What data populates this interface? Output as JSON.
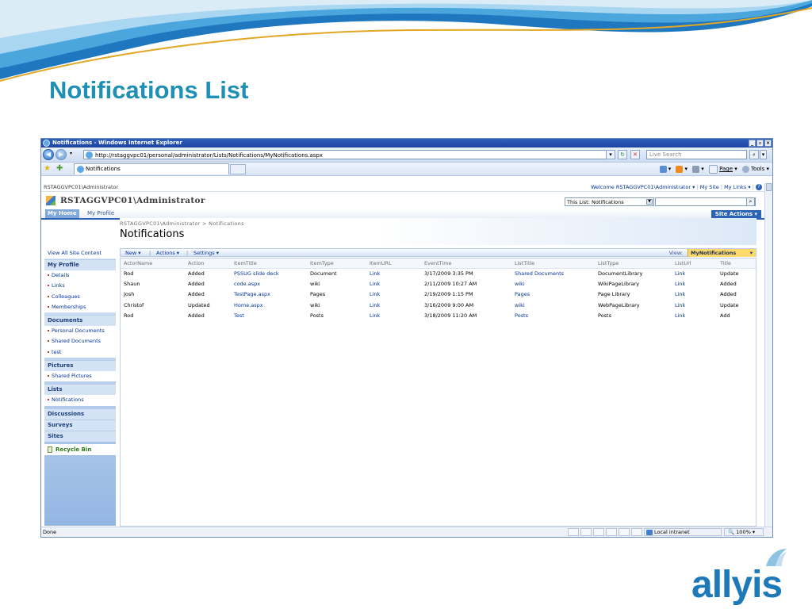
{
  "slide": {
    "title": "Notifications List",
    "logo": "allyis"
  },
  "browser": {
    "window_title": "Notifications - Windows Internet Explorer",
    "address": "http://rstaggvpc01/personal/administrator/Lists/Notifications/MyNotifications.aspx",
    "live_search_placeholder": "Live Search",
    "tab_label": "Notifications",
    "cmd_page": "Page",
    "cmd_tools": "Tools",
    "status_text": "Done",
    "zone_text": "Local intranet",
    "zoom_text": "100%"
  },
  "sharepoint": {
    "top_breadcrumb": "RSTAGGVPC01\\Administrator",
    "welcome": "Welcome RSTAGGVPC01\\Administrator ▾",
    "my_site": "My Site",
    "my_links": "My Links ▾",
    "site_title": "RSTAGGVPC01\\Administrator",
    "search_scope": "This List: Notifications",
    "nav_tabs": [
      "My Home",
      "My Profile"
    ],
    "site_actions": "Site Actions ▾",
    "breadcrumb": "RSTAGGVPC01\\Administrator > Notifications",
    "page_title": "Notifications",
    "toolbar": {
      "new": "New ▾",
      "actions": "Actions ▾",
      "settings": "Settings ▾",
      "view_label": "View:",
      "view_value": "MyNotifications"
    }
  },
  "leftnav": {
    "view_all": "View All Site Content",
    "my_profile": "My Profile",
    "profile_items": [
      "Details",
      "Links",
      "Colleagues",
      "Memberships"
    ],
    "documents": "Documents",
    "document_items": [
      "Personal Documents",
      "Shared Documents",
      "test"
    ],
    "pictures": "Pictures",
    "picture_items": [
      "Shared Pictures"
    ],
    "lists": "Lists",
    "list_items": [
      "Notifications"
    ],
    "discussions": "Discussions",
    "surveys": "Surveys",
    "sites": "Sites",
    "recycle_bin": "Recycle Bin"
  },
  "table": {
    "columns": [
      "ActorName",
      "Action",
      "ItemTitle",
      "ItemType",
      "ItemURL",
      "EventTime",
      "ListTitle",
      "ListType",
      "ListUrl",
      "Title"
    ],
    "rows": [
      [
        "Rod",
        "Added",
        "PSSUG slide deck",
        "Document",
        "Link",
        "3/17/2009 3:35 PM",
        "Shared Documents",
        "DocumentLibrary",
        "Link",
        "Update"
      ],
      [
        "Shaun",
        "Added",
        "code.aspx",
        "wiki",
        "Link",
        "2/11/2009 10:27 AM",
        "wiki",
        "WikiPageLibrary",
        "Link",
        "Added"
      ],
      [
        "Josh",
        "Added",
        "TestPage.aspx",
        "Pages",
        "Link",
        "2/19/2009 1:15 PM",
        "Pages",
        "Page Library",
        "Link",
        "Added"
      ],
      [
        "Christof",
        "Updated",
        "Home.aspx",
        "wiki",
        "Link",
        "3/16/2009 9:00 AM",
        "wiki",
        "WebPageLibrary",
        "Link",
        "Update"
      ],
      [
        "Rod",
        "Added",
        "Test",
        "Posts",
        "Link",
        "3/18/2009 11:20 AM",
        "Posts",
        "Posts",
        "Link",
        "Add"
      ]
    ]
  }
}
